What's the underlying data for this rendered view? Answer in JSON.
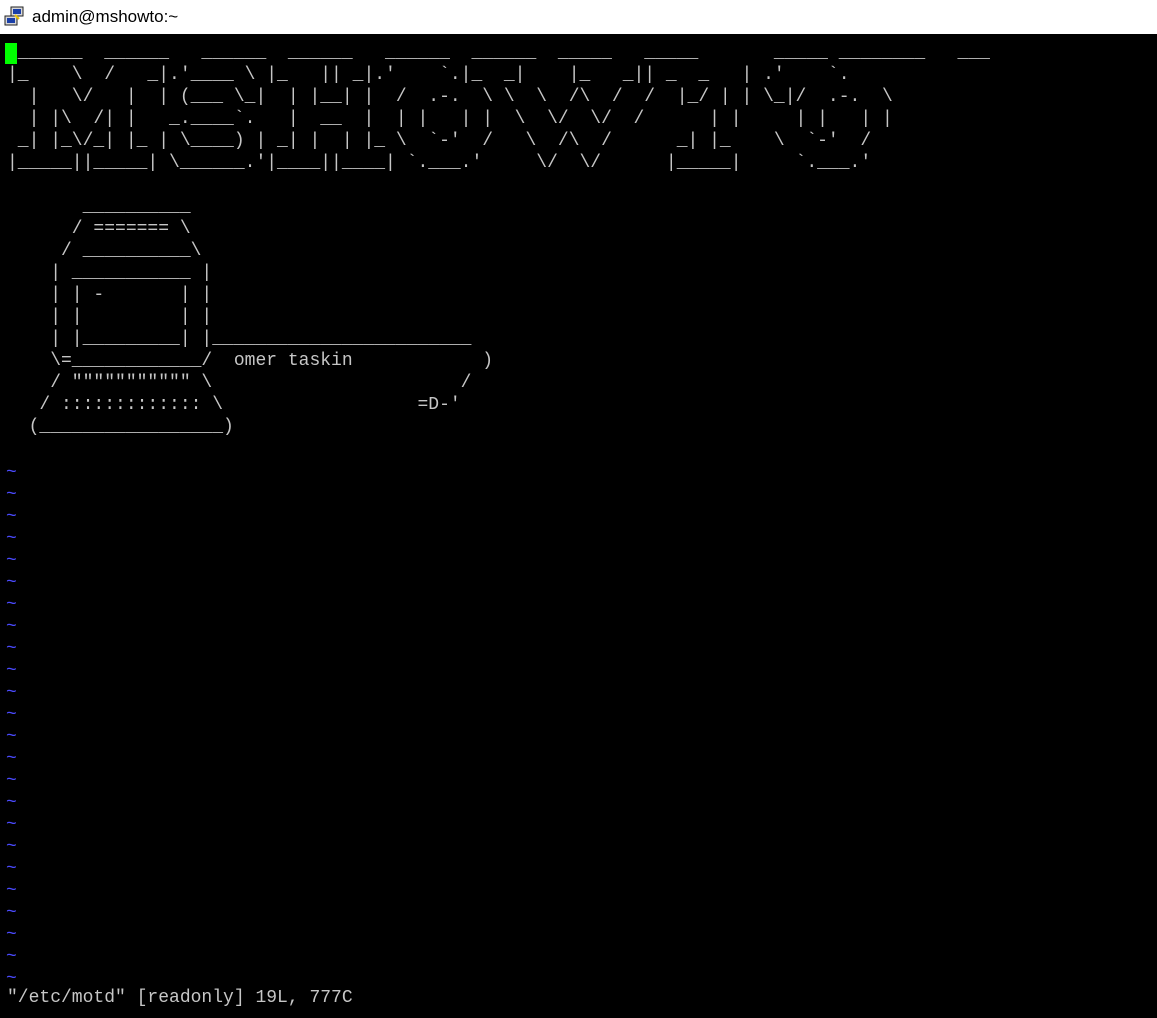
{
  "window": {
    "title": "admin@mshowto:~",
    "icon": "putty-icon"
  },
  "editor": {
    "file_lines": [
      " ______  ______   ______  ______   ______  ______  _____   _____       _____ ________   ___",
      "|_    \\  /   _|.'____ \\ |_   || _|.'    `.|_  _|    |_   _|| _  _   | .'    `.",
      "  |   \\/   |  | (___ \\_|  | |__| |  /  .-.  \\ \\  \\  /\\  /  /  |_/ | | \\_|/  .-.  \\",
      "  | |\\  /| |   _.____`.   |  __  |  | |   | |  \\  \\/  \\/  /      | |     | |   | |",
      " _| |_\\/_| |_ | \\____) | _| |  | |_ \\  `-'  /   \\  /\\  /      _| |_    \\  `-'  /",
      "|_____||_____| \\______.'|____||____| `.___.'     \\/  \\/      |_____|     `.___.'",
      "",
      "       __________",
      "      / ======= \\",
      "     / __________\\",
      "    | ___________ |",
      "    | | -       | |",
      "    | |         | |",
      "    | |_________| |________________________",
      "    \\=____________/  omer taskin            )",
      "    / \"\"\"\"\"\"\"\"\"\"\" \\                       /",
      "   / ::::::::::::: \\                  =D-'",
      "  (_________________)"
    ],
    "tilde_char": "~",
    "tilde_count": 24,
    "status_message": "\"/etc/motd\" [readonly] 19L, 777C"
  },
  "colors": {
    "background": "#000000",
    "text": "#c6c6c6",
    "cursor": "#00ff00",
    "tilde": "#4a4aff"
  }
}
